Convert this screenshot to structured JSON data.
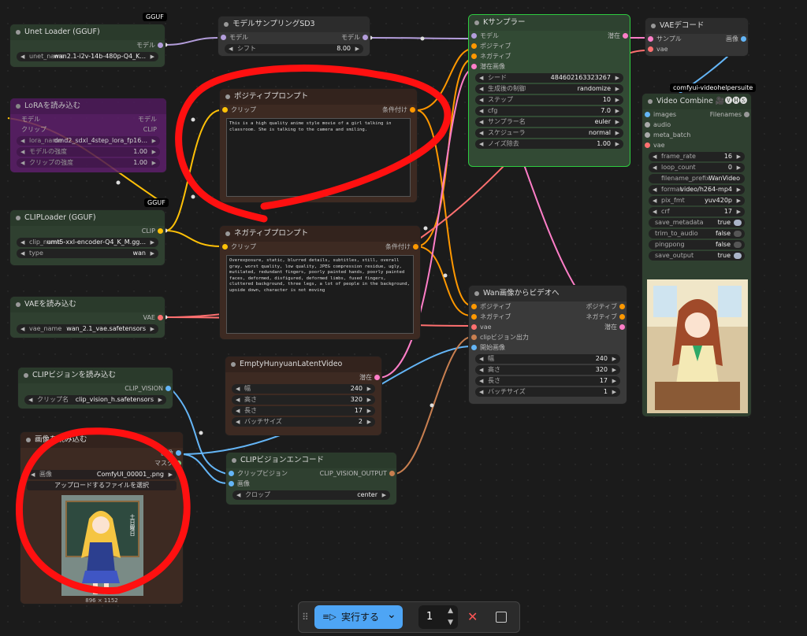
{
  "tags": {
    "gguf1": "GGUF",
    "gguf2": "GGUF",
    "videohelper": "comfyui-videohelpersuite"
  },
  "unet_loader": {
    "title": "Unet Loader (GGUF)",
    "out_label": "モデル",
    "widget_name": "unet_name",
    "widget_value": "wan2.1-i2v-14b-480p-Q4_K..."
  },
  "lora_loader": {
    "title": "LoRAを読み込む",
    "in_model": "モデル",
    "in_clip": "クリップ",
    "out_model": "モデル",
    "out_clip": "CLIP",
    "w1_name": "lora_name",
    "w1_value": "dmd2_sdxl_4step_lora_fp16...",
    "w2_name": "モデルの強度",
    "w2_value": "1.00",
    "w3_name": "クリップの強度",
    "w3_value": "1.00"
  },
  "clip_loader": {
    "title": "CLIPLoader (GGUF)",
    "out_label": "CLIP",
    "w1_name": "clip_name",
    "w1_value": "umt5-xxl-encoder-Q4_K_M.gg...",
    "w2_name": "type",
    "w2_value": "wan"
  },
  "vae_loader": {
    "title": "VAEを読み込む",
    "out_label": "VAE",
    "w_name": "vae_name",
    "w_value": "wan_2.1_vae.safetensors"
  },
  "clip_vision_loader": {
    "title": "CLIPビジョンを読み込む",
    "out_label": "CLIP_VISION",
    "w_name": "クリップ名",
    "w_value": "clip_vision_h.safetensors"
  },
  "image_loader": {
    "title": "画像を読み込む",
    "out_image": "画像",
    "out_mask": "マスク",
    "w_name": "画像",
    "w_value": "ComfyUI_00001_.png",
    "upload_label": "アップロードするファイルを選択",
    "dims": "896 × 1152",
    "chalkboard": "土日曜日"
  },
  "model_sampling": {
    "title": "モデルサンプリングSD3",
    "in_label": "モデル",
    "out_label": "モデル",
    "w_name": "シフト",
    "w_value": "8.00"
  },
  "positive_prompt": {
    "title": "ポジティブプロンプト",
    "in_label": "クリップ",
    "out_label": "条件付け",
    "text": "This is a high quality anime style movie of a girl talking in classroom. She is talking to the camera and smiling."
  },
  "negative_prompt": {
    "title": "ネガティブプロンプト",
    "in_label": "クリップ",
    "out_label": "条件付け",
    "text": "Overexposure, static, blurred details, subtitles, still, overall gray, worst quality, low quality, JPEG compression residue, ugly, mutilated, redundant fingers, poorly painted hands, poorly painted faces, deformed, disfigured, deformed limbs, fused fingers, cluttered background, three legs, a lot of people in the background, upside down, character is not moving"
  },
  "empty_latent": {
    "title": "EmptyHunyuanLatentVideo",
    "out_label": "潜在",
    "widgets": [
      {
        "name": "幅",
        "value": "240"
      },
      {
        "name": "高さ",
        "value": "320"
      },
      {
        "name": "長さ",
        "value": "17"
      },
      {
        "name": "バッチサイズ",
        "value": "2"
      }
    ]
  },
  "clip_vision_encode": {
    "title": "CLIPビジョンエンコード",
    "in1": "クリップビジョン",
    "in2": "画像",
    "out_label": "CLIP_VISION_OUTPUT",
    "w_name": "クロップ",
    "w_value": "center"
  },
  "ksampler": {
    "title": "Kサンプラー",
    "inputs": [
      "モデル",
      "ポジティブ",
      "ネガティブ",
      "潜在画像"
    ],
    "out_label": "潜在",
    "widgets": [
      {
        "name": "シード",
        "value": "484602163323267"
      },
      {
        "name": "生成後の制御",
        "value": "randomize"
      },
      {
        "name": "ステップ",
        "value": "10"
      },
      {
        "name": "cfg",
        "value": "7.0"
      },
      {
        "name": "サンプラー名",
        "value": "euler"
      },
      {
        "name": "スケジューラ",
        "value": "normal"
      },
      {
        "name": "ノイズ除去",
        "value": "1.00"
      }
    ]
  },
  "vae_decode": {
    "title": "VAEデコード",
    "in1": "サンプル",
    "in2": "vae",
    "out_label": "画像"
  },
  "wan_i2v": {
    "title": "Wan画像からビデオへ",
    "inputs": [
      "ポジティブ",
      "ネガティブ",
      "vae",
      "clipビジョン出力",
      "開始画像"
    ],
    "outputs": [
      "ポジティブ",
      "ネガティブ",
      "潜在"
    ],
    "widgets": [
      {
        "name": "幅",
        "value": "240"
      },
      {
        "name": "高さ",
        "value": "320"
      },
      {
        "name": "長さ",
        "value": "17"
      },
      {
        "name": "バッチサイズ",
        "value": "1"
      }
    ]
  },
  "video_combine": {
    "title": "Video Combine 🎥🅥🅗🅢",
    "help": "?",
    "inputs": [
      "images",
      "audio",
      "meta_batch",
      "vae"
    ],
    "out_label": "Filenames",
    "widgets": [
      {
        "name": "frame_rate",
        "value": "16"
      },
      {
        "name": "loop_count",
        "value": "0"
      },
      {
        "name": "filename_prefix",
        "value": "WanVideo"
      },
      {
        "name": "format",
        "value": "video/h264-mp4"
      },
      {
        "name": "pix_fmt",
        "value": "yuv420p"
      },
      {
        "name": "crf",
        "value": "17"
      }
    ],
    "toggles": [
      {
        "name": "save_metadata",
        "value": "true",
        "on": true
      },
      {
        "name": "trim_to_audio",
        "value": "false",
        "on": false
      },
      {
        "name": "pingpong",
        "value": "false",
        "on": false
      },
      {
        "name": "save_output",
        "value": "true",
        "on": true
      }
    ]
  },
  "toolbar": {
    "grip": "⠿",
    "queue_icon": "≡▷",
    "run_label": "実行する",
    "chevron": "⌄",
    "batch_count": "1",
    "close": "✕"
  },
  "colors": {
    "accent": "#4ea5f5",
    "annotation": "#ff1010",
    "ksampler_border": "#2ecc40"
  }
}
